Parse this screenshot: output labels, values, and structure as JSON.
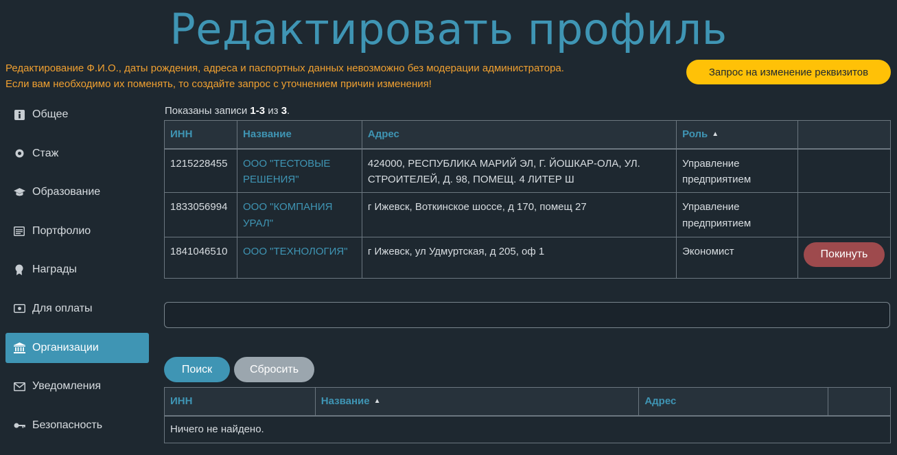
{
  "page": {
    "title": "Редактировать профиль",
    "notice_line1": "Редактирование Ф.И.О., даты рождения, адреса и паспортных данных невозможно без модерации администратора.",
    "notice_line2": "Если вам необходимо их поменять, то создайте запрос с уточнением причин изменения!",
    "request_button": "Запрос на изменение реквизитов"
  },
  "sidebar": {
    "items": [
      {
        "label": "Общее",
        "icon": "info-icon"
      },
      {
        "label": "Стаж",
        "icon": "gear-icon"
      },
      {
        "label": "Образование",
        "icon": "graduation-cap-icon"
      },
      {
        "label": "Портфолио",
        "icon": "list-icon"
      },
      {
        "label": "Награды",
        "icon": "award-icon"
      },
      {
        "label": "Для оплаты",
        "icon": "money-icon"
      },
      {
        "label": "Организации",
        "icon": "bank-icon",
        "active": true
      },
      {
        "label": "Уведомления",
        "icon": "envelope-icon"
      },
      {
        "label": "Безопасность",
        "icon": "key-icon"
      }
    ]
  },
  "orgs": {
    "summary_prefix": "Показаны записи ",
    "summary_range": "1-3",
    "summary_mid": " из ",
    "summary_total": "3",
    "summary_suffix": ".",
    "headers": {
      "inn": "ИНН",
      "name": "Название",
      "address": "Адрес",
      "role": "Роль"
    },
    "rows": [
      {
        "inn": "1215228455",
        "name": "ООО \"ТЕСТОВЫЕ РЕШЕНИЯ\"",
        "address": "424000, РЕСПУБЛИКА МАРИЙ ЭЛ, Г. ЙОШКАР-ОЛА, УЛ. СТРОИТЕЛЕЙ, Д. 98, ПОМЕЩ. 4 ЛИТЕР Ш",
        "role": "Управление предприятием"
      },
      {
        "inn": "1833056994",
        "name": "ООО \"КОМПАНИЯ УРАЛ\"",
        "address": "г Ижевск, Воткинское шоссе, д 170, помещ 27",
        "role": "Управление предприятием"
      },
      {
        "inn": "1841046510",
        "name": "ООО \"ТЕХНОЛОГИЯ\"",
        "address": "г Ижевск, ул Удмуртская, д 205, оф 1",
        "role": "Экономист",
        "action": "Покинуть"
      }
    ]
  },
  "search": {
    "input_value": "",
    "search_button": "Поиск",
    "reset_button": "Сбросить",
    "headers": {
      "inn": "ИНН",
      "name": "Название",
      "address": "Адрес"
    },
    "empty_text": "Ничего не найдено."
  },
  "colors": {
    "background": "#1e2830",
    "accent": "#3f95b4",
    "warning": "#f0a030",
    "request_button": "#ffc107",
    "leave_button": "#9e4a4d",
    "reset_button": "#9ba6ae"
  }
}
